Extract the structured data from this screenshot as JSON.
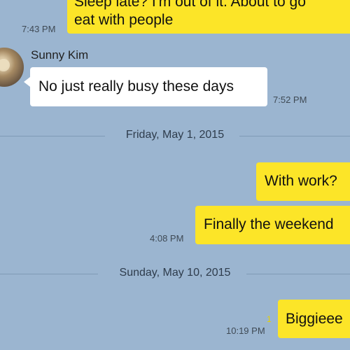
{
  "messages": [
    {
      "text": "Sleep late? I'm out of it. About to go\neat with people",
      "time": "7:43 PM"
    },
    {
      "sender": "Sunny Kim",
      "text": "No just really busy these days",
      "time": "7:52 PM"
    },
    {
      "text": "With work?"
    },
    {
      "text": "Finally the weekend",
      "time": "4:08 PM"
    },
    {
      "text": "Biggieee",
      "time": "10:19 PM",
      "unread": "1"
    }
  ],
  "dividers": [
    {
      "label": "Friday, May 1, 2015"
    },
    {
      "label": "Sunday, May 10, 2015"
    }
  ],
  "colors": {
    "background": "#9bb5d0",
    "mine_bubble": "#fce528",
    "their_bubble": "#ffffff"
  },
  "icons": {
    "avatar": "avatar-photo-icon"
  }
}
